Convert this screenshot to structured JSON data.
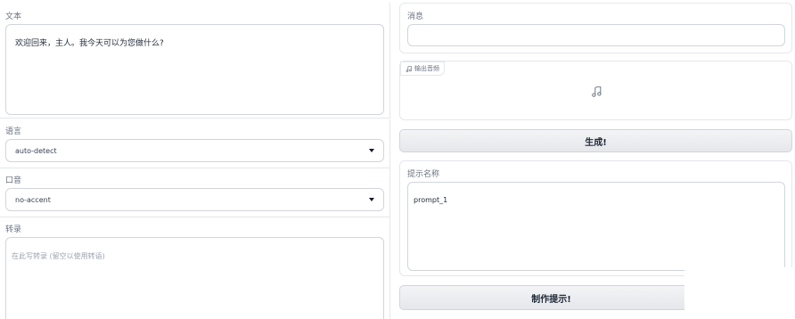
{
  "left": {
    "text_block": {
      "label": "文本",
      "value": "欢迎回来，主人。我今天可以为您做什么?"
    },
    "language": {
      "label": "语言",
      "selected": "auto-detect"
    },
    "accent": {
      "label": "口音",
      "selected": "no-accent"
    },
    "transcript": {
      "label": "转录",
      "placeholder": "在此写转录 (留空以使用转语)"
    }
  },
  "right": {
    "message": {
      "label": "消息",
      "value": ""
    },
    "output_audio": {
      "label": "输出音频",
      "icon": "music-note-icon"
    },
    "generate_button": {
      "label": "生成!"
    },
    "prompt_name": {
      "label": "提示名称",
      "value": "prompt_1"
    },
    "make_prompt_button": {
      "label": "制作提示!"
    }
  }
}
